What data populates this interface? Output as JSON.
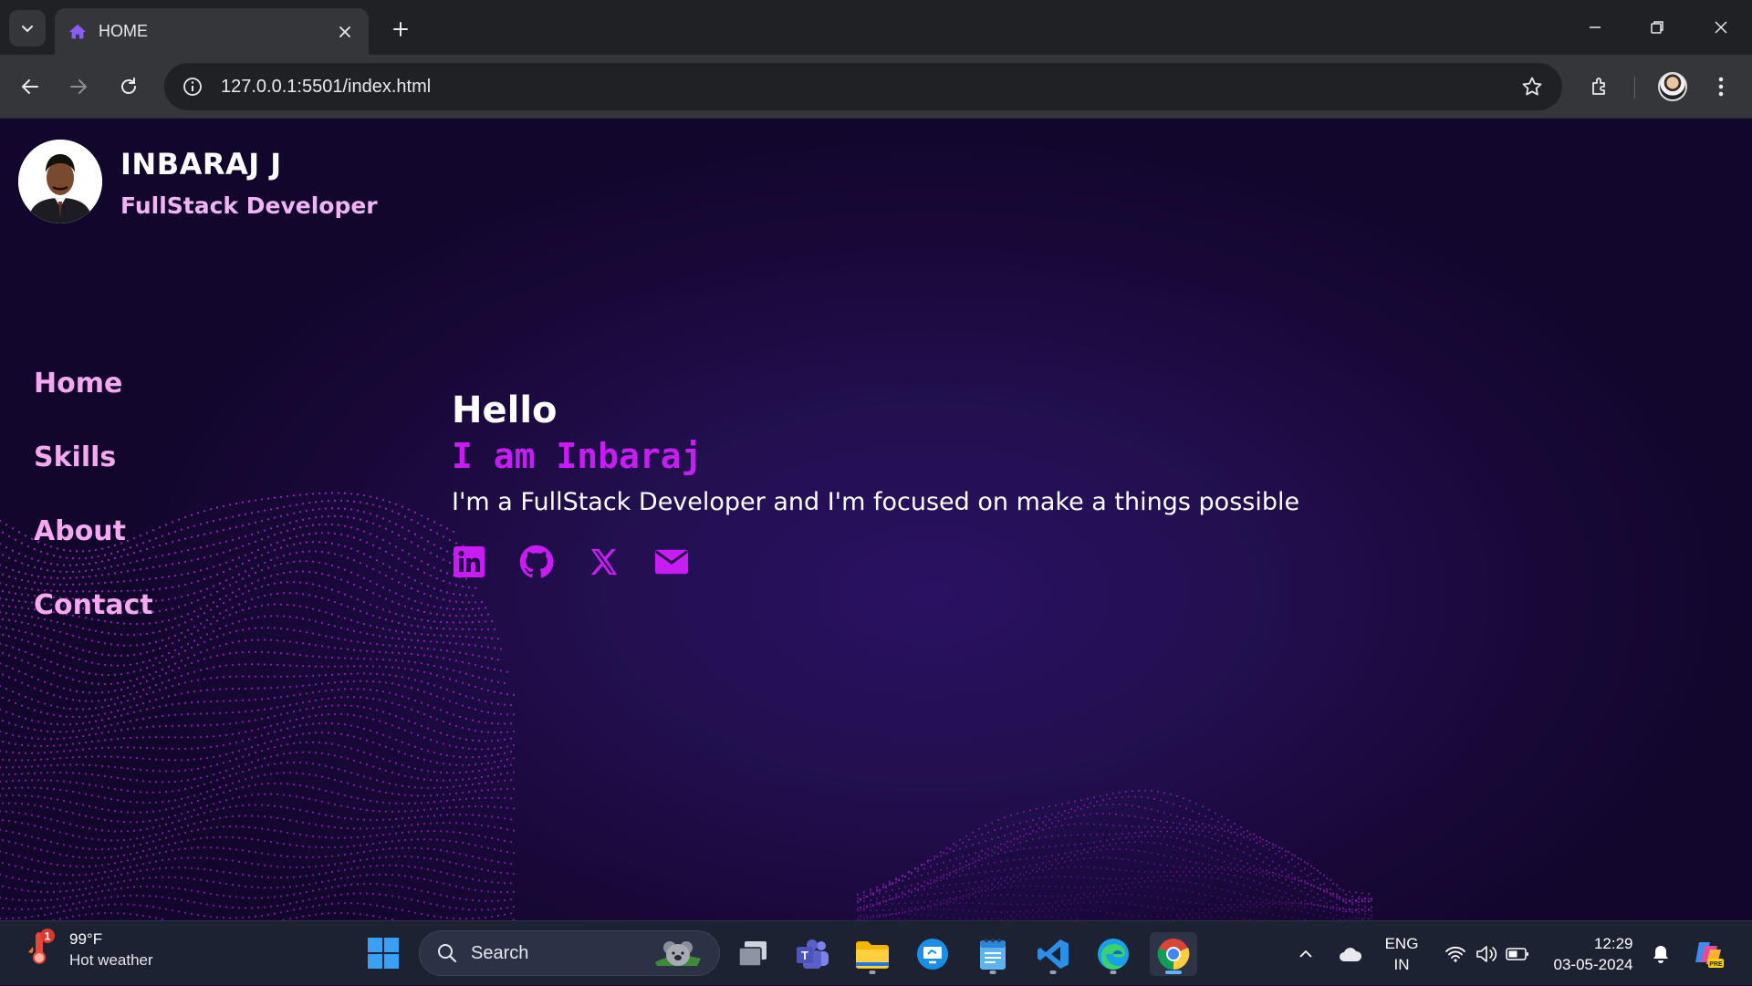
{
  "browser": {
    "tab_title": "HOME",
    "url": "127.0.0.1:5501/index.html"
  },
  "site": {
    "name": "INBARAJ J",
    "role": "FullStack Developer",
    "nav": [
      {
        "label": "Home"
      },
      {
        "label": "Skills"
      },
      {
        "label": "About"
      },
      {
        "label": "Contact"
      }
    ],
    "hero": {
      "greeting": "Hello",
      "intro": "I am Inbaraj",
      "tagline": "I'm a FullStack Developer and I'm focused on make a things possible"
    },
    "socials": [
      {
        "icon": "linkedin-icon"
      },
      {
        "icon": "github-icon"
      },
      {
        "icon": "x-icon"
      },
      {
        "icon": "mail-icon"
      }
    ],
    "colors": {
      "accent": "#c71df2",
      "nav": "#f3a8ef",
      "background": "#1a0838"
    }
  },
  "taskbar": {
    "weather_temp": "99°F",
    "weather_desc": "Hot weather",
    "weather_badge": "1",
    "search_label": "Search",
    "lang_line1": "ENG",
    "lang_line2": "IN",
    "time": "12:29",
    "date": "03-05-2024"
  }
}
